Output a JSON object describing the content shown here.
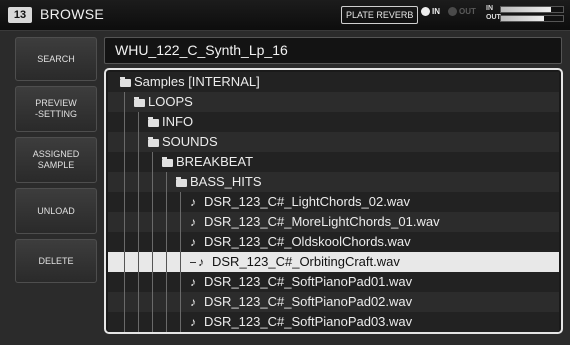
{
  "header": {
    "scene_number": "13",
    "title": "BROWSE",
    "fx_label": "PLATE REVERB",
    "in_label": "IN",
    "out_label": "OUT",
    "meter_in_label": "IN",
    "meter_out_label": "OUT"
  },
  "sidebar": {
    "search": "SEARCH",
    "preview_setting": "PREVIEW\n-SETTING",
    "assigned_sample": "ASSIGNED\nSAMPLE",
    "unload": "UNLOAD",
    "delete": "DELETE"
  },
  "path": "WHU_122_C_Synth_Lp_16",
  "tree": [
    {
      "label": "Samples [INTERNAL]",
      "type": "folder",
      "depth": 0
    },
    {
      "label": "LOOPS",
      "type": "folder",
      "depth": 1
    },
    {
      "label": "INFO",
      "type": "folder",
      "depth": 2
    },
    {
      "label": "SOUNDS",
      "type": "folder",
      "depth": 2
    },
    {
      "label": "BREAKBEAT",
      "type": "folder",
      "depth": 3
    },
    {
      "label": "BASS_HITS",
      "type": "folder",
      "depth": 4
    },
    {
      "label": "DSR_123_C#_LightChords_02.wav",
      "type": "file",
      "depth": 5
    },
    {
      "label": "DSR_123_C#_MoreLightChords_01.wav",
      "type": "file",
      "depth": 5
    },
    {
      "label": "DSR_123_C#_OldskoolChords.wav",
      "type": "file",
      "depth": 5
    },
    {
      "label": "DSR_123_C#_OrbitingCraft.wav",
      "type": "file",
      "depth": 5,
      "selected": true
    },
    {
      "label": "DSR_123_C#_SoftPianoPad01.wav",
      "type": "file",
      "depth": 5
    },
    {
      "label": "DSR_123_C#_SoftPianoPad02.wav",
      "type": "file",
      "depth": 5
    },
    {
      "label": "DSR_123_C#_SoftPianoPad03.wav",
      "type": "file",
      "depth": 5
    }
  ],
  "icons": {
    "folder": "folder-icon",
    "file": "note-icon"
  },
  "meters": {
    "in_level": 0.8,
    "out_level": 0.7
  }
}
